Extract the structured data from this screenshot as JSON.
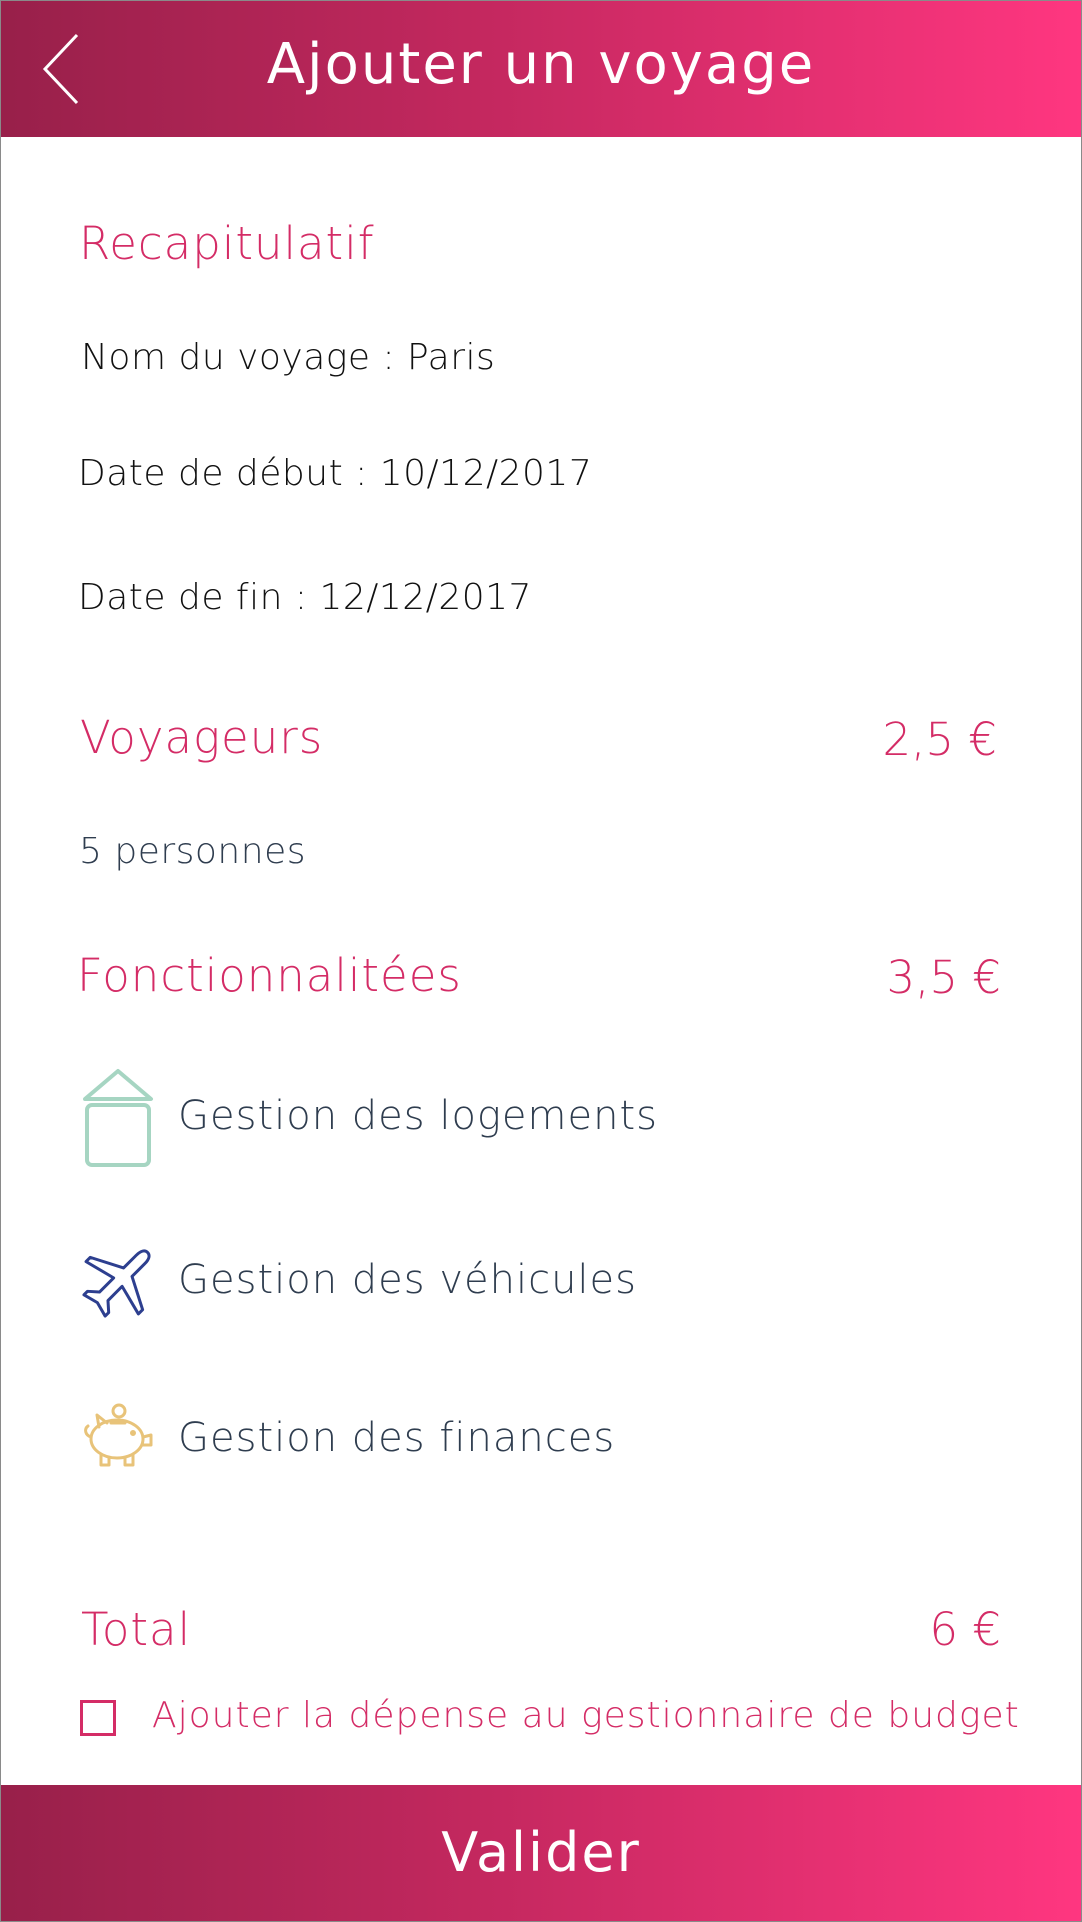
{
  "header": {
    "title": "Ajouter un voyage",
    "back_icon": "chevron-left-icon"
  },
  "recap": {
    "title": "Recapitulatif",
    "trip_name": "Nom du voyage : Paris",
    "start_date": "Date de début : 10/12/2017",
    "end_date": "Date de fin : 12/12/2017"
  },
  "travelers": {
    "title": "Voyageurs",
    "price": "2,5 €",
    "count": "5 personnes"
  },
  "features": {
    "title": "Fonctionnalitées",
    "price": "3,5 €",
    "items": [
      {
        "label": "Gestion des logements",
        "icon": "house-icon",
        "color": "#a6d5c2"
      },
      {
        "label": "Gestion des véhicules",
        "icon": "airplane-icon",
        "color": "#2d3f8f"
      },
      {
        "label": "Gestion des finances",
        "icon": "piggy-bank-icon",
        "color": "#e8c379"
      }
    ]
  },
  "total": {
    "label": "Total",
    "price": "6 €"
  },
  "budget_option": {
    "label": "Ajouter la dépense au gestionnaire de budget",
    "checked": false
  },
  "footer": {
    "button_label": "Valider"
  },
  "colors": {
    "accent": "#d42c66",
    "gradient_start": "#98204a",
    "gradient_end": "#ff3680"
  }
}
